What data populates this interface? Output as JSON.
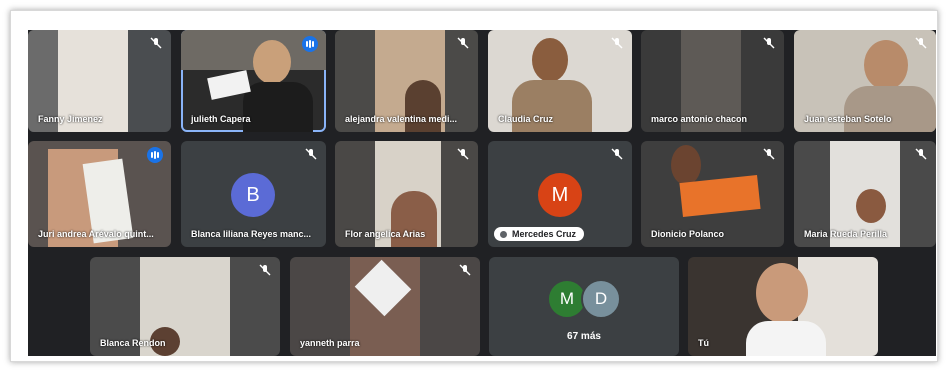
{
  "meeting": {
    "participants": [
      {
        "name": "Fanny Jimenez",
        "status": "muted"
      },
      {
        "name": "julieth Capera",
        "status": "speaking"
      },
      {
        "name": "alejandra valentina medi...",
        "status": "muted"
      },
      {
        "name": "Claudia Cruz",
        "status": "muted"
      },
      {
        "name": "marco antonio chacon",
        "status": "muted"
      },
      {
        "name": "Juan esteban Sotelo",
        "status": "muted"
      },
      {
        "name": "Juri andrea Arévalo quint...",
        "status": "speaking"
      },
      {
        "name": "Blanca liliana Reyes manc...",
        "status": "muted",
        "avatar_letter": "B",
        "avatar_color": "#5b6bd6"
      },
      {
        "name": "Flor angelica Arias",
        "status": "muted"
      },
      {
        "name": "Mercedes Cruz",
        "status": "muted",
        "avatar_letter": "M",
        "avatar_color": "#d84315"
      },
      {
        "name": "Dionicio Polanco",
        "status": "muted"
      },
      {
        "name": "Maria Rueda Perilla",
        "status": "muted"
      },
      {
        "name": "Blanca Rendon",
        "status": "muted"
      },
      {
        "name": "yanneth parra",
        "status": "muted"
      },
      {
        "name": "Tú",
        "status": "self"
      }
    ],
    "overflow": {
      "avatars": [
        {
          "letter": "M",
          "color": "#2e7d32"
        },
        {
          "letter": "D",
          "color": "#78909c"
        }
      ],
      "label": "67 más"
    },
    "icons": {
      "muted": "mic-off-icon",
      "speaking": "audio-level-icon"
    }
  }
}
